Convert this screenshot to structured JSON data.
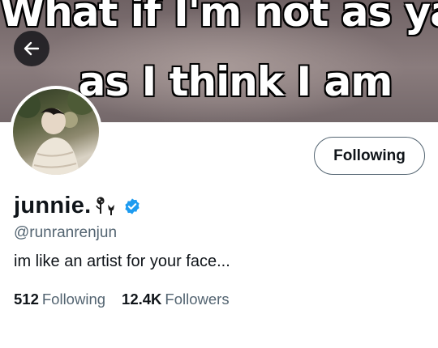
{
  "banner": {
    "line1": "What if I'm not as yass",
    "line2": "as I think I am"
  },
  "nav": {
    "back_icon": "arrow-left-icon"
  },
  "profile": {
    "display_name": "junnie.",
    "name_emoji": "flower-emoji",
    "verified_icon": "verified-badge-icon",
    "handle": "@runranrenjun",
    "bio": "im like an artist for your face...",
    "follow_button_label": "Following"
  },
  "stats": {
    "following_count": "512",
    "following_label": "Following",
    "followers_count": "12.4K",
    "followers_label": "Followers"
  },
  "colors": {
    "verified_blue": "#1d9bf0",
    "text_primary": "#0f1419",
    "text_secondary": "#536471"
  }
}
